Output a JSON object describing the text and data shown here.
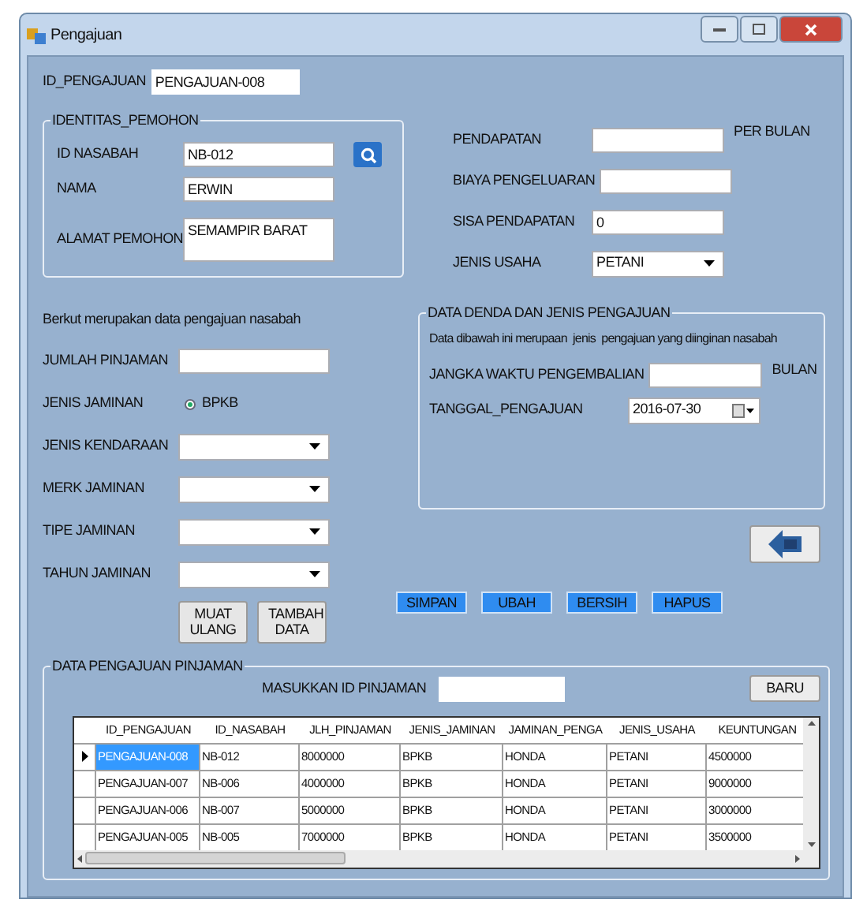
{
  "window": {
    "title": "Pengajuan"
  },
  "id_pengajuan": {
    "label": "ID_PENGAJUAN",
    "value": "PENGAJUAN-008"
  },
  "identitas": {
    "title": "IDENTITAS_PEMOHON",
    "fields": [
      {
        "kind": "search",
        "label": "ID NASABAH",
        "value": "NB-012"
      },
      {
        "kind": "text",
        "label": "NAMA",
        "value": "ERWIN"
      },
      {
        "kind": "area",
        "label": "ALAMAT PEMOHON",
        "value": "SEMAMPIR BARAT"
      }
    ]
  },
  "income": {
    "fields": [
      {
        "kind": "text",
        "label": "PENDAPATAN",
        "suffix": "PER BULAN"
      },
      {
        "kind": "text",
        "label": "BIAYA PENGELUARAN"
      },
      {
        "kind": "text",
        "label": "SISA PENDAPATAN",
        "value": "0"
      },
      {
        "kind": "combo",
        "label": "JENIS USAHA",
        "value": "PETANI"
      }
    ]
  },
  "loan": {
    "intro": "Berkut merupakan data pengajuan nasabah",
    "fields": [
      {
        "kind": "text",
        "label": "JUMLAH PINJAMAN"
      },
      {
        "kind": "radio",
        "label": "JENIS JAMINAN",
        "option": "BPKB",
        "selected": true
      },
      {
        "kind": "combo",
        "label": "JENIS KENDARAAN"
      },
      {
        "kind": "combo",
        "label": "MERK JAMINAN"
      },
      {
        "kind": "combo",
        "label": "TIPE JAMINAN"
      },
      {
        "kind": "combo",
        "label": "TAHUN JAMINAN"
      }
    ],
    "buttons": [
      "MUAT ULANG",
      "TAMBAH DATA"
    ]
  },
  "denda": {
    "title": "DATA DENDA DAN JENIS PENGAJUAN",
    "note": "Data dibawah ini merupaan  jenis  pengajuan yang diinginan nasabah",
    "fields": [
      {
        "kind": "text",
        "label": "JANGKA WAKTU PENGEMBALIAN",
        "suffix": "BULAN"
      },
      {
        "kind": "date",
        "label": "TANGGAL_PENGAJUAN",
        "value": "2016-07-30"
      }
    ]
  },
  "actions": [
    "SIMPAN",
    "UBAH",
    "BERSIH",
    "HAPUS"
  ],
  "list": {
    "title": "DATA PENGAJUAN PINJAMAN",
    "search_label": "MASUKKAN ID PINJAMAN",
    "new_button": "BARU",
    "table": {
      "columns": [
        "ID_PENGAJUAN",
        "ID_NASABAH",
        "JLH_PINJAMAN",
        "JENIS_JAMINAN",
        "JAMINAN_PENGA",
        "JENIS_USAHA",
        "KEUNTUNGAN"
      ],
      "rows": [
        {
          "selected": true,
          "cells": [
            "PENGAJUAN-008",
            "NB-012",
            "8000000",
            "BPKB",
            "HONDA",
            "PETANI",
            "4500000"
          ]
        },
        {
          "selected": false,
          "cells": [
            "PENGAJUAN-007",
            "NB-006",
            "4000000",
            "BPKB",
            "HONDA",
            "PETANI",
            "9000000"
          ]
        },
        {
          "selected": false,
          "cells": [
            "PENGAJUAN-006",
            "NB-007",
            "5000000",
            "BPKB",
            "HONDA",
            "PETANI",
            "3000000"
          ]
        },
        {
          "selected": false,
          "cells": [
            "PENGAJUAN-005",
            "NB-005",
            "7000000",
            "BPKB",
            "HONDA",
            "PETANI",
            "3500000"
          ]
        }
      ]
    }
  }
}
